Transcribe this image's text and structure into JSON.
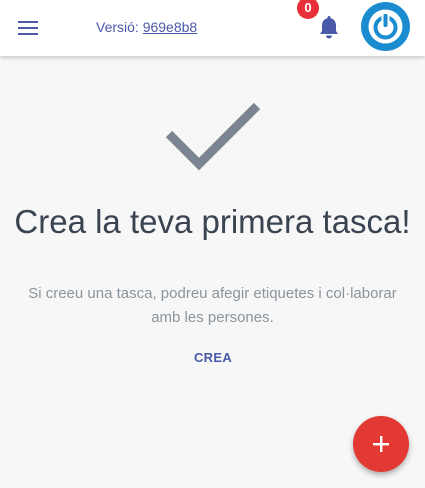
{
  "header": {
    "version_label": "Versió:",
    "version_hash": "969e8b8",
    "notification_count": "0",
    "menu_icon": "hamburger-menu-icon",
    "notification_icon": "bell-icon",
    "avatar_icon": "power-icon",
    "avatar_color": "#1a8ccf"
  },
  "empty_state": {
    "icon": "checkmark-icon",
    "title": "Crea la teva primera tasca!",
    "subtitle": "Si creeu una tasca, podreu afegir etiquetes i col·laborar amb les persones.",
    "create_label": "CREA"
  },
  "fab": {
    "icon": "plus-icon",
    "color": "#e23a33"
  },
  "colors": {
    "accent": "#4a5aa8",
    "badge": "#e8303a",
    "check": "#7b8591"
  }
}
